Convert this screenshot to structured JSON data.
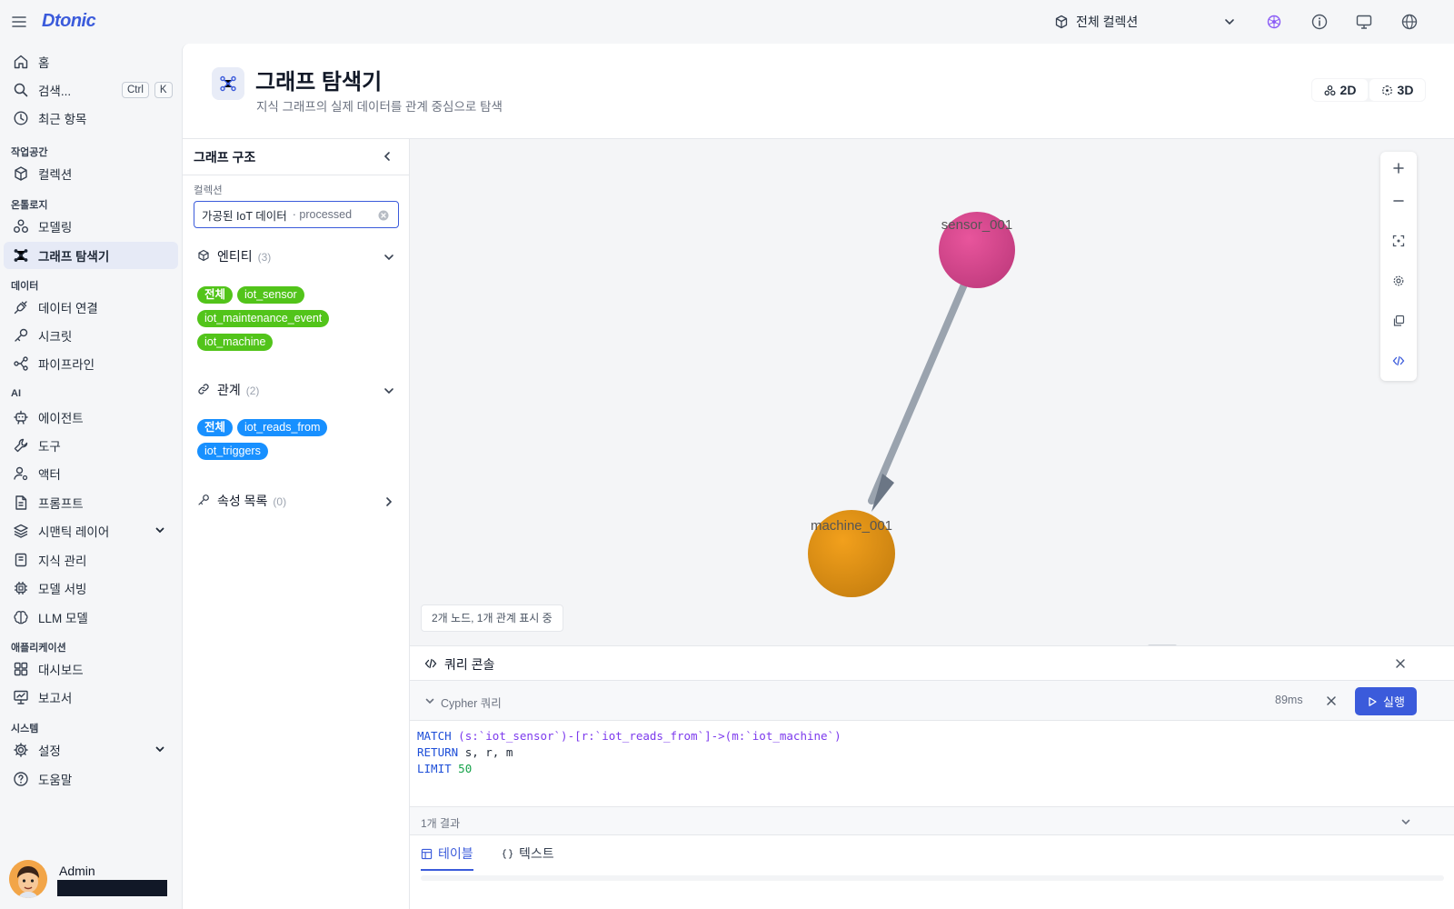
{
  "app": {
    "logo": "Dtonic"
  },
  "topbar": {
    "collection_selector": "전체 컬렉션"
  },
  "sidebar": {
    "home": "홈",
    "search": "검색...",
    "search_shortcut": [
      "Ctrl",
      "K"
    ],
    "recent": "최근 항목",
    "sections": {
      "workspace": "작업공간",
      "ontology": "온톨로지",
      "data": "데이터",
      "ai": "AI",
      "applications": "애플리케이션",
      "system": "시스템"
    },
    "items": {
      "collections": "컬렉션",
      "modeling": "모델링",
      "graph_explorer": "그래프 탐색기",
      "data_connections": "데이터 연결",
      "secrets": "시크릿",
      "pipelines": "파이프라인",
      "agents": "에이전트",
      "tools": "도구",
      "actors": "액터",
      "prompts": "프롬프트",
      "semantic_layer": "시맨틱 레이어",
      "knowledge_mgmt": "지식 관리",
      "model_serving": "모델 서빙",
      "llm_models": "LLM 모델",
      "dashboards": "대시보드",
      "reports": "보고서",
      "settings": "설정",
      "help": "도움말"
    },
    "user": {
      "name": "Admin"
    }
  },
  "page": {
    "title": "그래프 탐색기",
    "subtitle": "지식 그래프의 실제 데이터를 관계 중심으로 탐색",
    "view_2d": "2D",
    "view_3d": "3D"
  },
  "structure_panel": {
    "title": "그래프 구조",
    "collection_label": "컬렉션",
    "collection_value": "가공된 IoT 데이터",
    "collection_tag": "· processed",
    "entities": {
      "title": "엔티티",
      "count": "(3)",
      "chips": [
        "전체",
        "iot_sensor",
        "iot_maintenance_event",
        "iot_machine"
      ]
    },
    "relations": {
      "title": "관계",
      "count": "(2)",
      "chips": [
        "전체",
        "iot_reads_from",
        "iot_triggers"
      ]
    },
    "properties": {
      "title": "속성 목록",
      "count": "(0)"
    }
  },
  "graph": {
    "nodes": [
      {
        "id": "sensor_001",
        "color": "#d63c8a"
      },
      {
        "id": "machine_001",
        "color": "#e8950f"
      }
    ],
    "edge_color": "#9aa3ae",
    "status": "2개 노드, 1개 관계 표시 중"
  },
  "console": {
    "title": "쿼리 콘솔",
    "query_label": "Cypher 쿼리",
    "elapsed": "89ms",
    "run_label": "실행",
    "query": {
      "line1_kw": "MATCH",
      "line1_rest": "(s:`iot_sensor`)-[r:`iot_reads_from`]->(m:`iot_machine`)",
      "line2_kw": "RETURN",
      "line2_rest": "s, r, m",
      "line3_kw": "LIMIT",
      "line3_num": "50"
    },
    "result_count": "1개 결과",
    "tabs": [
      "테이블",
      "텍스트"
    ]
  },
  "colors": {
    "accent": "#3b5bdb",
    "entity_chip": "#52c41a",
    "relation_chip": "#1890ff"
  }
}
